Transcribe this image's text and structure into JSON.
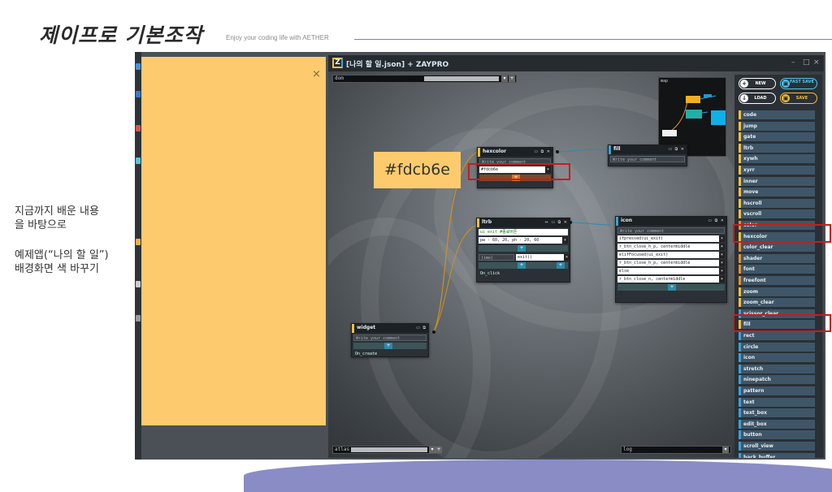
{
  "slide": {
    "title": "제이프로 기본조작",
    "subtitle": "Enjoy your coding life with AETHER",
    "note_line1": "지금까지 배운 내용",
    "note_line2": "을 바탕으로",
    "note_line3": "예제앱(“나의 할 일”)",
    "note_line4": "배경화면 색 바꾸기",
    "accent_color": "#6f7fd6"
  },
  "sticky_note": {
    "color": "#fdcb6e",
    "close": "×"
  },
  "callout": {
    "text": "#fdcb6e"
  },
  "app": {
    "title": "[나의 할 일.json] + ZAYPRO",
    "logo": "Z",
    "controls": [
      "–",
      "□",
      "×"
    ],
    "top_bar_label": "dom",
    "atlas_label": "atlas",
    "log_label": "log",
    "minimap_label": "map"
  },
  "nodes": {
    "hexcolor": {
      "title": "hexcolor",
      "comment": "Write your comment",
      "value": "#fdcb6e"
    },
    "fill": {
      "title": "fill",
      "comment": "Write your comment"
    },
    "ltrb": {
      "title": "ltrb",
      "row1": "ui_exit #종료버튼",
      "row2": "pw - 60, 20, ph - 20, 60",
      "row3a": "(ime)",
      "row3b": "exit()",
      "row4": "On_click"
    },
    "icon": {
      "title": "icon",
      "comment": "Write your comment",
      "rows": [
        "ifpressed(ui_exit)",
        "r_btn_close_h_p, centermiddle",
        "elifFocused(ui_exit)",
        "r_btn_close_h_p, centermiddle",
        "else",
        "r_btn_close_n, centermiddle"
      ]
    },
    "widget": {
      "title": "widget",
      "comment": "Write your comment",
      "row": "On_create"
    }
  },
  "sidebar": {
    "new_label": "NEW",
    "fast_save_label": "FAST SAVE",
    "load_label": "LOAD",
    "save_label": "SAVE",
    "commands": [
      "code",
      "jump",
      "gate",
      "ltrb",
      "xywh",
      "xyrr",
      "inner",
      "move",
      "hscroll",
      "vscroll",
      "color",
      "hexcolor",
      "color_clear",
      "shader",
      "font",
      "freefont",
      "zoom",
      "zoom_clear",
      "scissor_clear",
      "fill",
      "rect",
      "circle",
      "icon",
      "stretch",
      "ninepatch",
      "pattern",
      "text",
      "text_box",
      "edit_box",
      "button",
      "scroll_view",
      "back_buffer"
    ]
  },
  "icons": {
    "close": "close-icon",
    "plus": "plus-icon",
    "new": "plus-circle-icon",
    "load": "download-icon",
    "save": "save-icon"
  }
}
